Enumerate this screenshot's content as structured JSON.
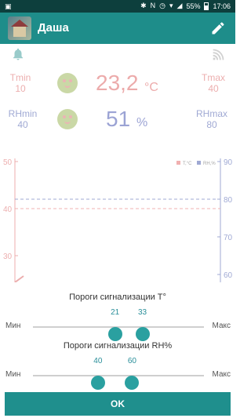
{
  "status_bar": {
    "battery": "55%",
    "time": "17:06"
  },
  "app_bar": {
    "title": "Даша"
  },
  "monitor": {
    "tmin_label": "Tmin",
    "tmin_value": "10",
    "tmax_label": "Tmax",
    "tmax_value": "40",
    "temperature": "23,2",
    "temperature_unit": "°C",
    "rhmin_label": "RHmin",
    "rhmin_value": "40",
    "rhmax_label": "RHmax",
    "rhmax_value": "80",
    "humidity": "51",
    "humidity_unit": "%"
  },
  "chart_data": {
    "type": "line",
    "legend": [
      "T,°C",
      "RH,%"
    ],
    "legend_colors": [
      "#e05050",
      "#2a3f9e"
    ],
    "left_axis": {
      "ticks": [
        50,
        40,
        30
      ],
      "color": "#d54a4a"
    },
    "right_axis": {
      "ticks": [
        90,
        80,
        70,
        60
      ],
      "color": "#2a3f9e"
    },
    "threshold_lines": [
      {
        "series": "RH,%",
        "value": 80
      },
      {
        "series": "T,°C",
        "value": 40
      }
    ]
  },
  "dialog": {
    "temp_title": "Пороги сигнализации T°",
    "temp_min_label": "Мин",
    "temp_max_label": "Макс",
    "temp_low": "21",
    "temp_high": "33",
    "temp_low_fraction": 0.48,
    "temp_high_fraction": 0.64,
    "rh_title": "Пороги сигнализации RH%",
    "rh_min_label": "Мин",
    "rh_max_label": "Макс",
    "rh_low": "40",
    "rh_high": "60",
    "rh_low_fraction": 0.38,
    "rh_high_fraction": 0.58,
    "ok_label": "OK"
  },
  "colors": {
    "accent": "#1f8f8d",
    "status_bar": "#0d3f3d",
    "temperature": "#d64545",
    "humidity": "#2233a0"
  }
}
